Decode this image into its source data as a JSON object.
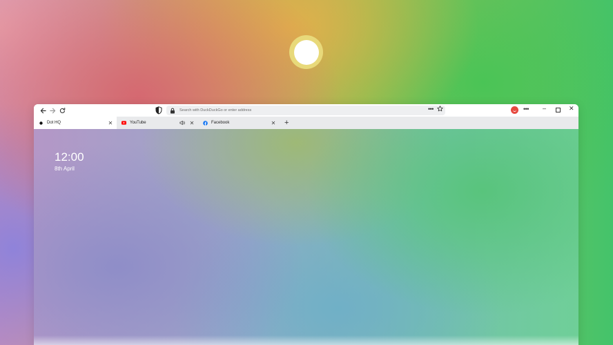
{
  "browser": {
    "url_placeholder": "Search with DuckDuckGo or enter address",
    "tabs": [
      {
        "title": "Dot HQ",
        "active": true,
        "icon": "dot-icon"
      },
      {
        "title": "YouTube",
        "active": false,
        "icon": "youtube-icon",
        "audio": true
      },
      {
        "title": "Facebook",
        "active": false,
        "icon": "facebook-icon"
      }
    ],
    "new_tab_label": "+",
    "accent_colors": {
      "profile": "#e6493f",
      "youtube": "#ff0000",
      "facebook": "#1877f2"
    }
  },
  "newtab": {
    "time": "12:00",
    "date": "8th April"
  }
}
